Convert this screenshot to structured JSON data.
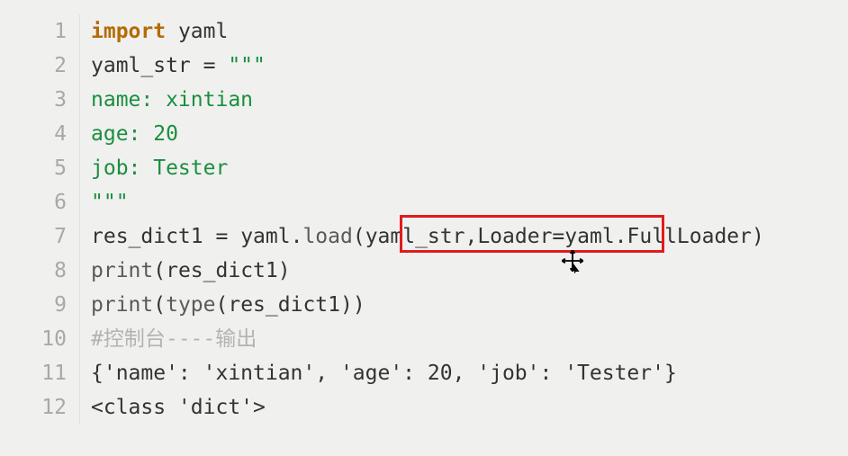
{
  "editor": {
    "lines": [
      {
        "n": "1",
        "segments": [
          {
            "cls": "kw",
            "t": "import"
          },
          {
            "cls": "name",
            "t": " yaml"
          }
        ]
      },
      {
        "n": "2",
        "segments": [
          {
            "cls": "name",
            "t": "yaml_str "
          },
          {
            "cls": "op",
            "t": "= "
          },
          {
            "cls": "str",
            "t": "\"\"\""
          }
        ]
      },
      {
        "n": "3",
        "segments": [
          {
            "cls": "str",
            "t": "name: xintian"
          }
        ]
      },
      {
        "n": "4",
        "segments": [
          {
            "cls": "str",
            "t": "age: 20"
          }
        ]
      },
      {
        "n": "5",
        "segments": [
          {
            "cls": "str",
            "t": "job: Tester"
          }
        ]
      },
      {
        "n": "6",
        "segments": [
          {
            "cls": "str",
            "t": "\"\"\""
          }
        ]
      },
      {
        "n": "7",
        "segments": [
          {
            "cls": "name",
            "t": "res_dict1 "
          },
          {
            "cls": "op",
            "t": "= "
          },
          {
            "cls": "name",
            "t": "yaml"
          },
          {
            "cls": "op",
            "t": "."
          },
          {
            "cls": "call",
            "t": "load"
          },
          {
            "cls": "op",
            "t": "("
          },
          {
            "cls": "name",
            "t": "yaml_str"
          },
          {
            "cls": "op",
            "t": ","
          },
          {
            "cls": "name",
            "t": "Loader"
          },
          {
            "cls": "op",
            "t": "="
          },
          {
            "cls": "name",
            "t": "yaml"
          },
          {
            "cls": "op",
            "t": "."
          },
          {
            "cls": "name",
            "t": "FullLoader"
          },
          {
            "cls": "op",
            "t": ")"
          }
        ]
      },
      {
        "n": "8",
        "segments": [
          {
            "cls": "call",
            "t": "print"
          },
          {
            "cls": "op",
            "t": "("
          },
          {
            "cls": "name",
            "t": "res_dict1"
          },
          {
            "cls": "op",
            "t": ")"
          }
        ]
      },
      {
        "n": "9",
        "segments": [
          {
            "cls": "call",
            "t": "print"
          },
          {
            "cls": "op",
            "t": "("
          },
          {
            "cls": "call",
            "t": "type"
          },
          {
            "cls": "op",
            "t": "("
          },
          {
            "cls": "name",
            "t": "res_dict1"
          },
          {
            "cls": "op",
            "t": "))"
          }
        ]
      },
      {
        "n": "10",
        "segments": [
          {
            "cls": "comment",
            "t": "#控制台----输出"
          }
        ]
      },
      {
        "n": "11",
        "segments": [
          {
            "cls": "dictout",
            "t": "{'name': 'xintian', 'age': 20, 'job': 'Tester'}"
          }
        ]
      },
      {
        "n": "12",
        "segments": [
          {
            "cls": "dictout",
            "t": "<class 'dict'>"
          }
        ]
      }
    ]
  }
}
